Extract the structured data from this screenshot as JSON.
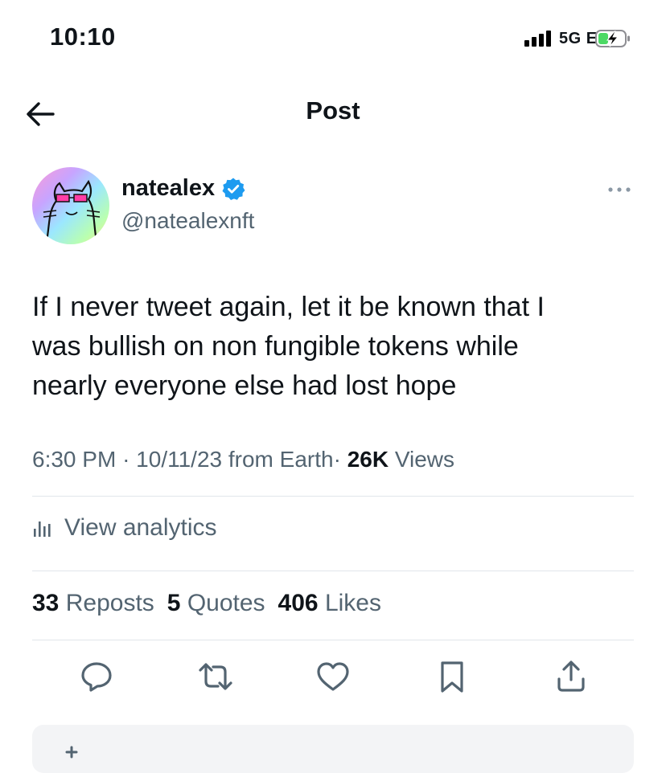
{
  "status_bar": {
    "time": "10:10",
    "network": "5G E",
    "battery_level": 0.35,
    "battery_charging": true,
    "battery_color": "#4cd964"
  },
  "header": {
    "title": "Post",
    "back_icon": "arrow-left-icon"
  },
  "author": {
    "display_name": "natealex",
    "handle": "@natealexnft",
    "verified": true,
    "verified_color": "#1d9bf0",
    "avatar": "rainbow-cat-avatar"
  },
  "tweet": {
    "text_lines": [
      "If I never tweet again, let it be known that I",
      "was bullish on non fungible tokens while",
      "nearly everyone else had lost hope"
    ],
    "time": "6:30 PM",
    "date": "10/11/23",
    "source": "from Earth",
    "views_count": "26K",
    "views_label": "Views"
  },
  "analytics": {
    "label": "View analytics",
    "icon": "bar-chart-icon"
  },
  "stats": {
    "reposts_count": "33",
    "reposts_label": "Reposts",
    "quotes_count": "5",
    "quotes_label": "Quotes",
    "likes_count": "406",
    "likes_label": "Likes"
  },
  "actions": [
    {
      "icon": "reply-icon"
    },
    {
      "icon": "repost-icon"
    },
    {
      "icon": "like-icon"
    },
    {
      "icon": "bookmark-icon"
    },
    {
      "icon": "share-icon"
    }
  ],
  "colors": {
    "text": "#0f1419",
    "secondary": "#536471",
    "divider": "#e1e6ea"
  }
}
